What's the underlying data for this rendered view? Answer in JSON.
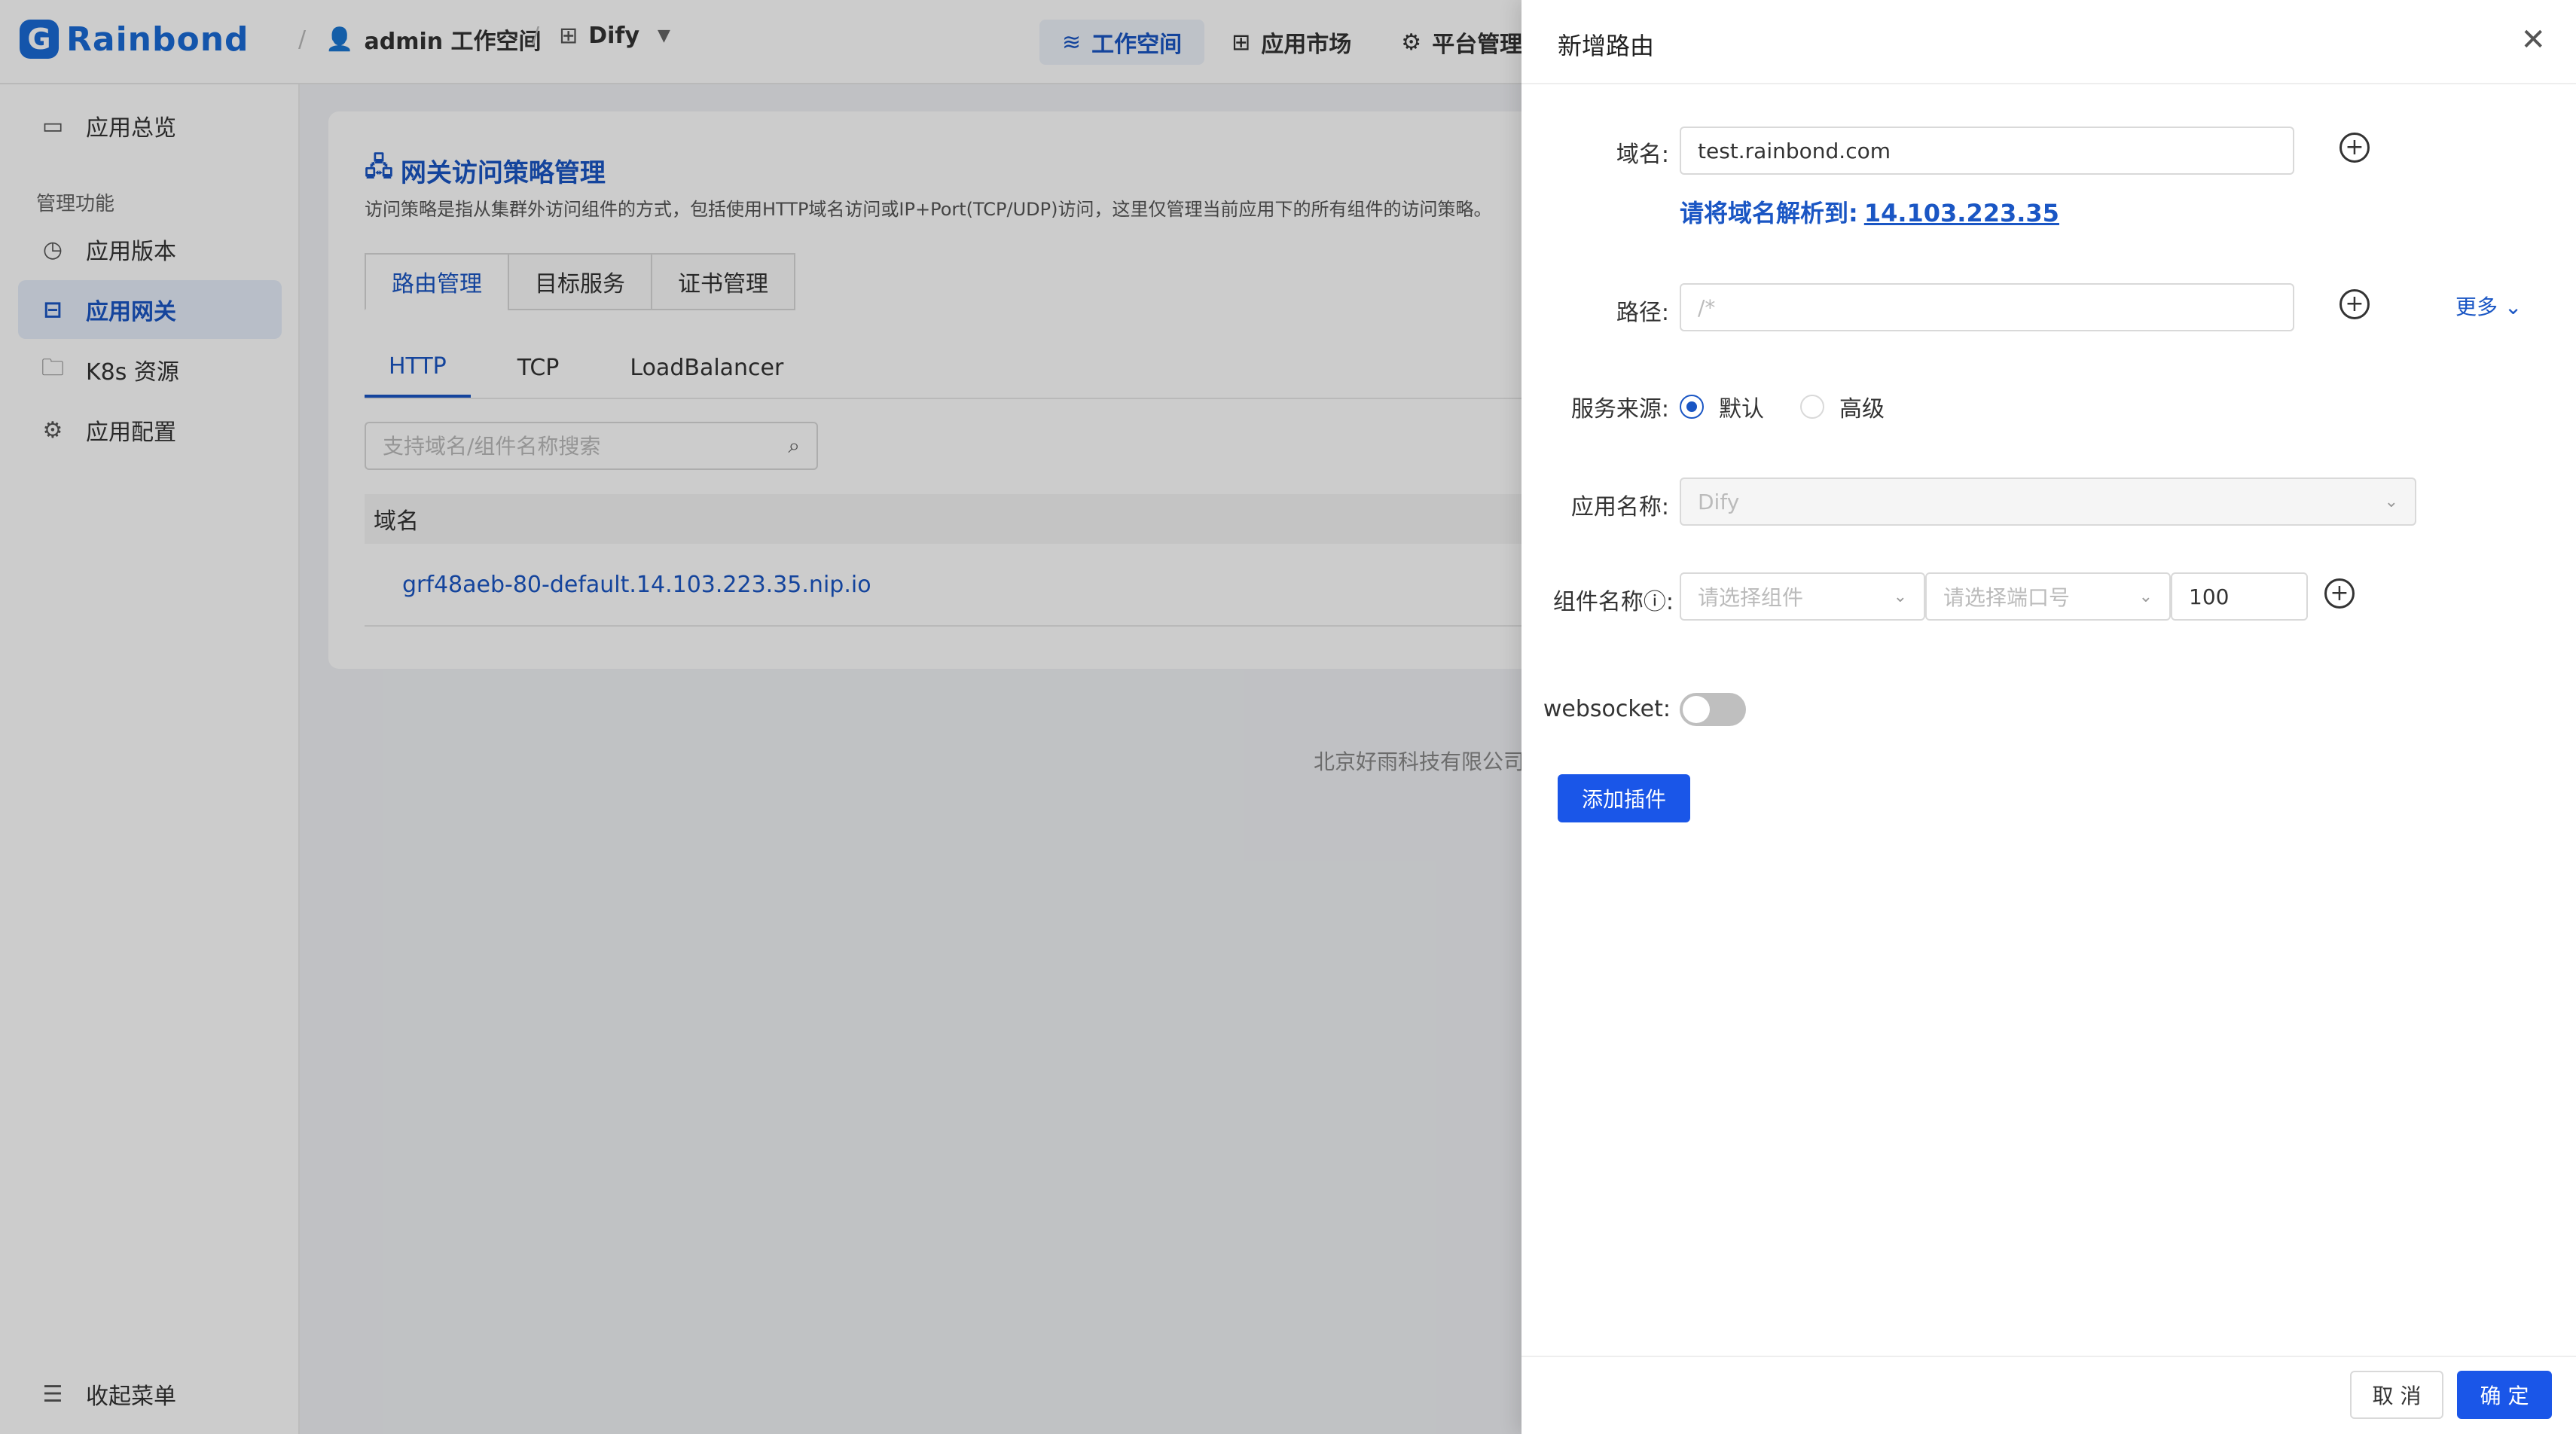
{
  "header": {
    "logo_text": "Rainbond",
    "workspace": "admin 工作空间",
    "app": "Dify",
    "nav": [
      {
        "label": "工作空间",
        "icon": "layers-icon"
      },
      {
        "label": "应用市场",
        "icon": "grid-icon"
      },
      {
        "label": "平台管理",
        "icon": "gear-icon"
      }
    ]
  },
  "sidebar": {
    "overview": "应用总览",
    "group_label": "管理功能",
    "items": [
      {
        "label": "应用版本",
        "icon": "clock-icon"
      },
      {
        "label": "应用网关",
        "icon": "gateway-icon"
      },
      {
        "label": "K8s 资源",
        "icon": "folder-icon"
      },
      {
        "label": "应用配置",
        "icon": "gear-icon"
      }
    ],
    "collapse": "收起菜单"
  },
  "main": {
    "title": "网关访问策略管理",
    "description": "访问策略是指从集群外访问组件的方式，包括使用HTTP域名访问或IP+Port(TCP/UDP)访问，这里仅管理当前应用下的所有组件的访问策略。",
    "card_tabs": [
      "路由管理",
      "目标服务",
      "证书管理"
    ],
    "line_tabs": [
      "HTTP",
      "TCP",
      "LoadBalancer"
    ],
    "search_placeholder": "支持域名/组件名称搜索",
    "table_header": "域名",
    "rows": [
      "grf48aeb-80-default.14.103.223.35.nip.io"
    ],
    "footer": "北京好雨科技有限公司"
  },
  "drawer": {
    "title": "新增路由",
    "domain_label": "域名:",
    "domain_value": "test.rainbond.com",
    "hint_text": "请将域名解析到:",
    "hint_ip": "14.103.223.35",
    "path_label": "路径:",
    "path_placeholder": "/*",
    "more": "更多",
    "source_label": "服务来源:",
    "source_options": [
      "默认",
      "高级"
    ],
    "app_label": "应用名称:",
    "app_value": "Dify",
    "component_label": "组件名称",
    "component_placeholder": "请选择组件",
    "port_placeholder": "请选择端口号",
    "weight_value": "100",
    "websocket_label": "websocket:",
    "add_plugin": "添加插件",
    "cancel": "取 消",
    "ok": "确 定"
  }
}
